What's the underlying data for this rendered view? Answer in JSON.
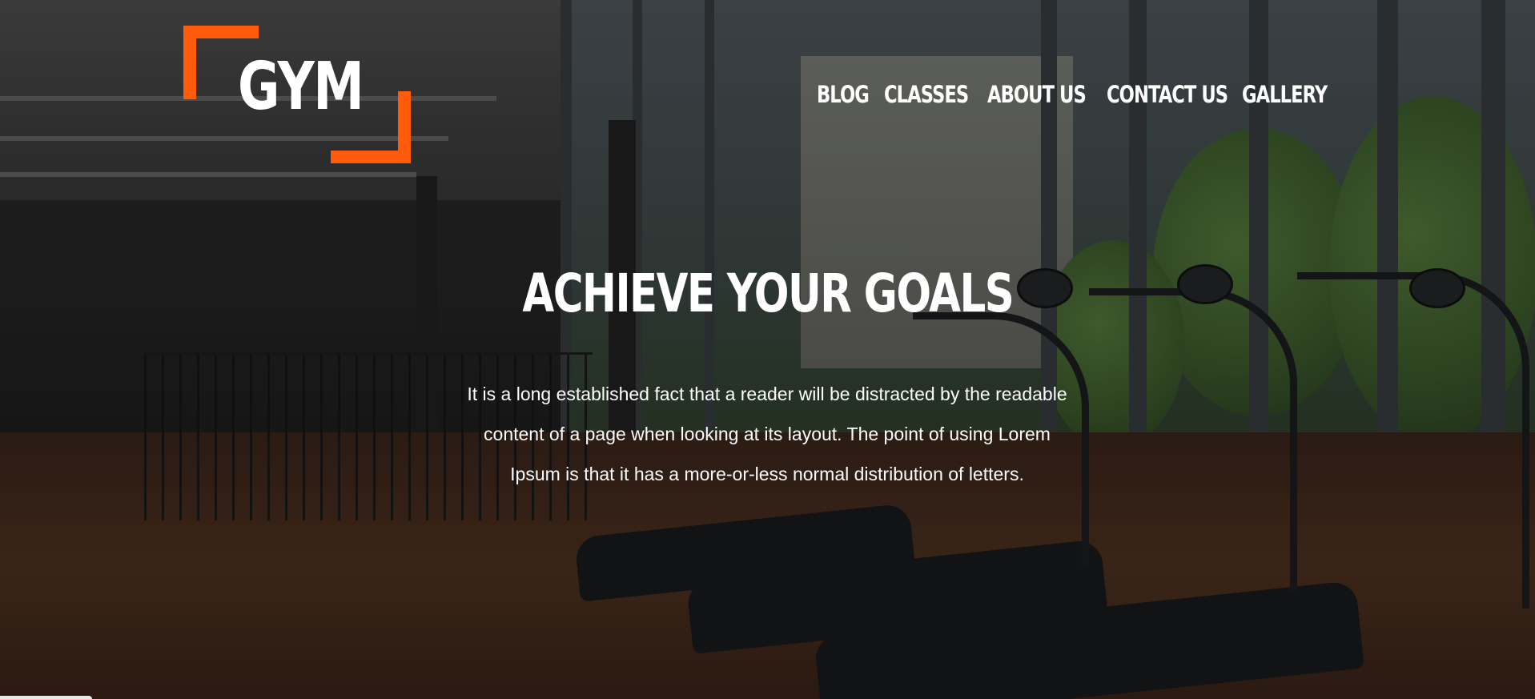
{
  "brand": {
    "logo_text": "GYM",
    "accent_color": "#ff5b0b"
  },
  "nav": {
    "items": [
      {
        "label": "BLOG"
      },
      {
        "label": "CLASSES"
      },
      {
        "label": "ABOUT US"
      },
      {
        "label": "CONTACT US"
      },
      {
        "label": "GALLERY"
      }
    ]
  },
  "hero": {
    "headline": "ACHIEVE YOUR GOALS",
    "lead": "It is a long established fact that a reader will be distracted by the readable content of a page when looking at its layout. The point of using Lorem Ipsum is that it has a more-or-less normal distribution of letters.",
    "background": "gym-interior-photo"
  }
}
